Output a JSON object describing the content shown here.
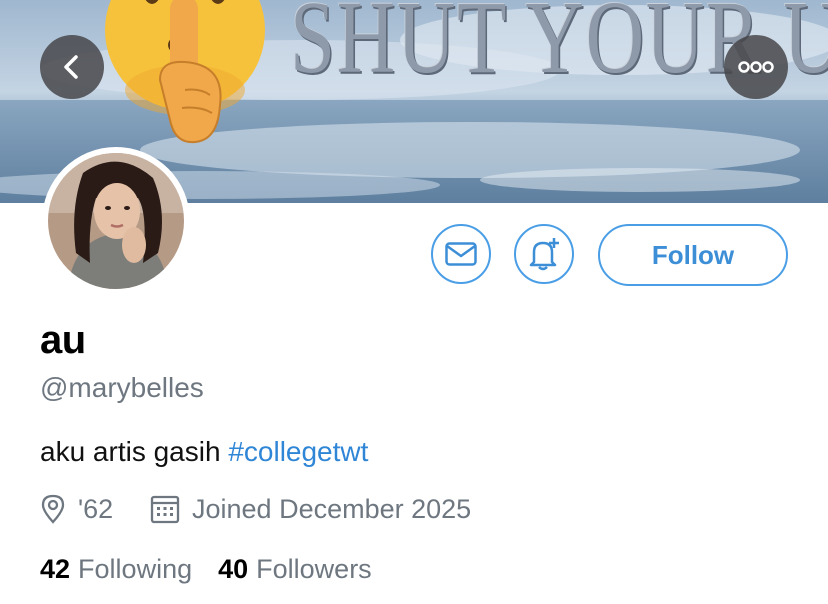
{
  "banner": {
    "text": "SHUT YOUR UP",
    "emoji_icon": "shushing-face-icon"
  },
  "header": {
    "back_icon": "chevron-left-icon",
    "more_icon": "more-horizontal-icon"
  },
  "actions": {
    "message_icon": "mail-icon",
    "notify_icon": "bell-plus-icon",
    "follow_label": "Follow"
  },
  "profile": {
    "name": "au",
    "handle": "@marybelles",
    "bio_text": "aku artis gasih ",
    "bio_hashtag": "#collegetwt",
    "location": "'62",
    "joined": "Joined December 2025"
  },
  "stats": {
    "following_count": "42",
    "following_label": "Following",
    "followers_count": "40",
    "followers_label": "Followers"
  },
  "colors": {
    "accent": "#4a9ee6",
    "secondary_text": "#6e7780"
  }
}
